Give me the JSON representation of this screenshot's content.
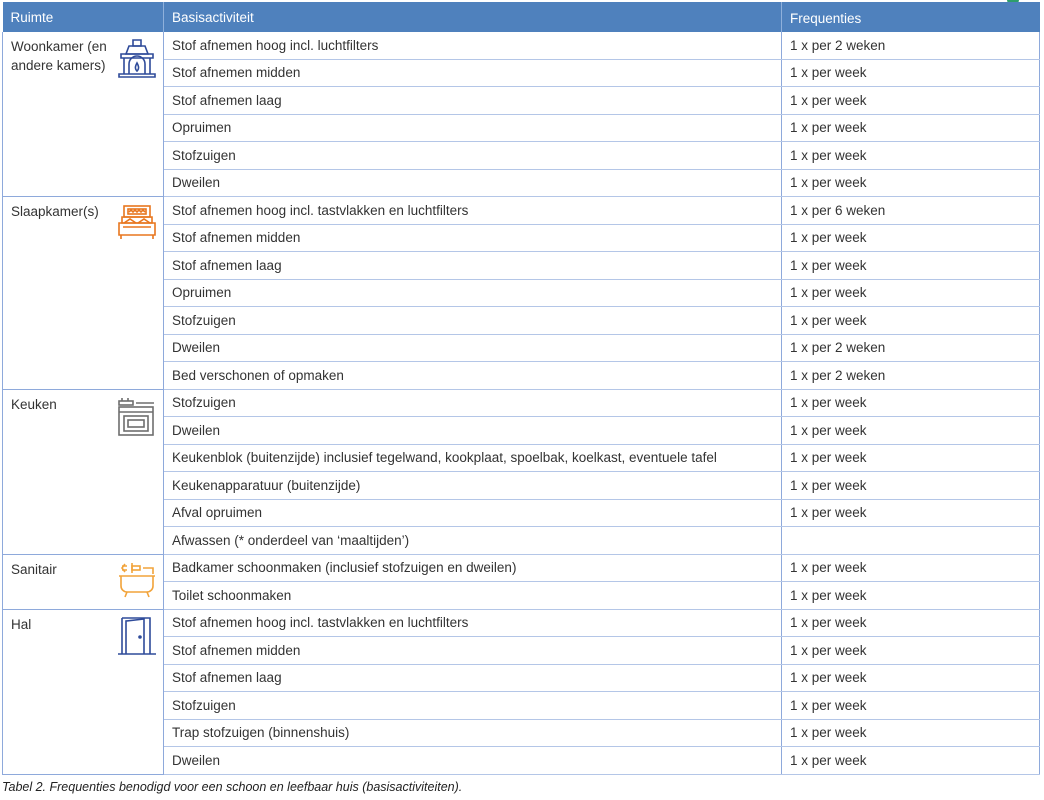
{
  "table": {
    "headers": [
      "Ruimte",
      "Basisactiviteit",
      "Frequenties"
    ],
    "rooms": [
      {
        "name": "Woonkamer (en andere kamers)",
        "icon": "fireplace-icon",
        "icon_color": "#2F4B9A",
        "rows": [
          {
            "activity": "Stof afnemen hoog incl. luchtfilters",
            "frequency": "1 x per 2 weken"
          },
          {
            "activity": "Stof afnemen midden",
            "frequency": "1 x per week"
          },
          {
            "activity": "Stof afnemen laag",
            "frequency": "1 x per week"
          },
          {
            "activity": "Opruimen",
            "frequency": "1 x per week"
          },
          {
            "activity": "Stofzuigen",
            "frequency": "1 x per week"
          },
          {
            "activity": "Dweilen",
            "frequency": "1 x per week"
          }
        ]
      },
      {
        "name": "Slaapkamer(s)",
        "icon": "bed-icon",
        "icon_color": "#E8761E",
        "rows": [
          {
            "activity": "Stof afnemen hoog incl. tastvlakken en luchtfilters",
            "frequency": "1 x per 6 weken"
          },
          {
            "activity": "Stof afnemen midden",
            "frequency": "1 x per week"
          },
          {
            "activity": "Stof afnemen laag",
            "frequency": "1 x per week"
          },
          {
            "activity": "Opruimen",
            "frequency": "1 x per week"
          },
          {
            "activity": "Stofzuigen",
            "frequency": "1 x per week"
          },
          {
            "activity": "Dweilen",
            "frequency": "1 x per 2 weken"
          },
          {
            "activity": "Bed verschonen of opmaken",
            "frequency": "1 x per 2 weken"
          }
        ]
      },
      {
        "name": "Keuken",
        "icon": "stove-icon",
        "icon_color": "#6E6E6E",
        "rows": [
          {
            "activity": "Stofzuigen",
            "frequency": "1 x per week"
          },
          {
            "activity": "Dweilen",
            "frequency": "1 x per week"
          },
          {
            "activity": "Keukenblok (buitenzijde) inclusief tegelwand, kookplaat, spoelbak, koelkast, eventuele tafel",
            "frequency": "1 x per week"
          },
          {
            "activity": "Keukenapparatuur (buitenzijde)",
            "frequency": "1 x per week"
          },
          {
            "activity": "Afval opruimen",
            "frequency": "1 x per week"
          },
          {
            "activity": "Afwassen (* onderdeel van ‘maaltijden’)",
            "frequency": ""
          }
        ]
      },
      {
        "name": "Sanitair",
        "icon": "bathtub-icon",
        "icon_color": "#F2A33A",
        "rows": [
          {
            "activity": "Badkamer schoonmaken (inclusief stofzuigen en dweilen)",
            "frequency": "1 x per week"
          },
          {
            "activity": "Toilet schoonmaken",
            "frequency": "1 x per week"
          }
        ]
      },
      {
        "name": "Hal",
        "icon": "door-icon",
        "icon_color": "#2F4B9A",
        "rows": [
          {
            "activity": "Stof afnemen hoog incl. tastvlakken en luchtfilters",
            "frequency": "1 x per week"
          },
          {
            "activity": "Stof afnemen midden",
            "frequency": "1 x per week"
          },
          {
            "activity": "Stof afnemen laag",
            "frequency": "1 x per week"
          },
          {
            "activity": "Stofzuigen",
            "frequency": "1 x per week"
          },
          {
            "activity": "Trap stofzuigen (binnenshuis)",
            "frequency": "1 x per week"
          },
          {
            "activity": "Dweilen",
            "frequency": "1 x per week"
          }
        ]
      }
    ]
  },
  "caption": "Tabel 2. Frequenties benodigd voor een schoon en leefbaar huis (basisactiviteiten).",
  "colors": {
    "header_bg": "#4F81BD",
    "grid": "#B4C6E7"
  }
}
